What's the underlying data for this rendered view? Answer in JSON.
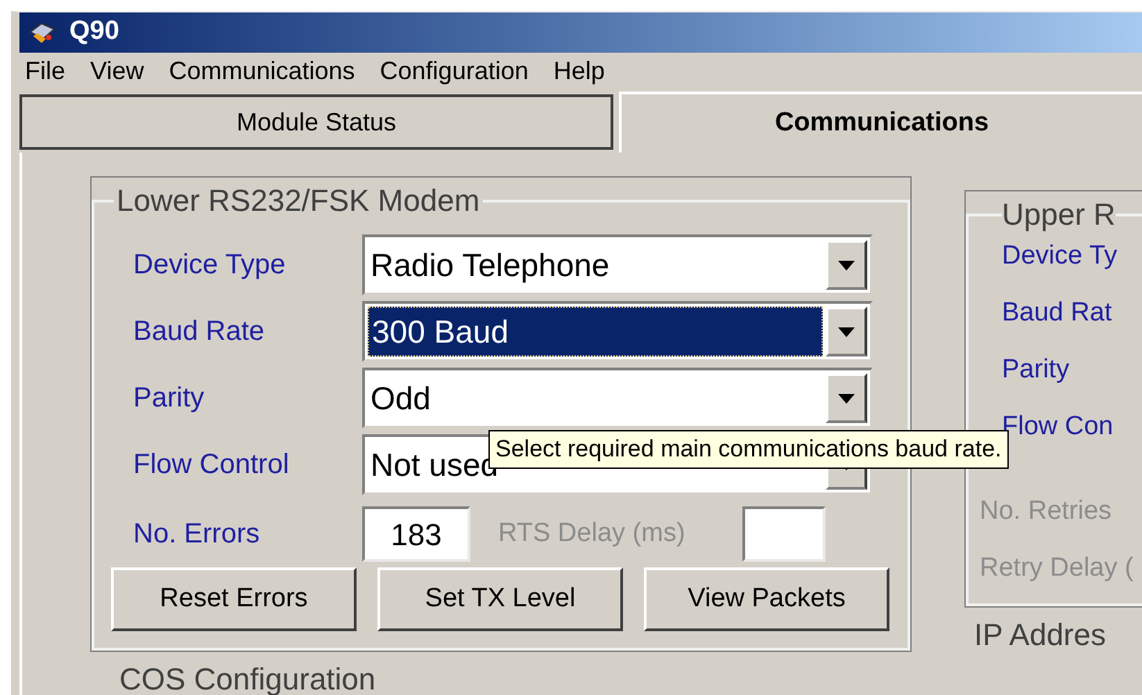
{
  "window": {
    "title": "Q90"
  },
  "menu": [
    "File",
    "View",
    "Communications",
    "Configuration",
    "Help"
  ],
  "tabs": [
    {
      "label": "Module Status",
      "selected": false
    },
    {
      "label": "Communications",
      "selected": true
    }
  ],
  "lower_group": {
    "title": "Lower RS232/FSK Modem",
    "fields": [
      {
        "label": "Device Type",
        "value": "Radio Telephone",
        "focused": false
      },
      {
        "label": "Baud Rate",
        "value": "300 Baud",
        "focused": true
      },
      {
        "label": "Parity",
        "value": "Odd",
        "focused": false
      },
      {
        "label": "Flow Control",
        "value": "Not used",
        "focused": false
      }
    ],
    "errors": {
      "label": "No. Errors",
      "value": "183",
      "disabled": false
    },
    "rts_delay": {
      "label": "RTS Delay (ms)",
      "disabled": true
    },
    "buttons": [
      "Reset Errors",
      "Set TX Level",
      "View Packets"
    ]
  },
  "cos_group": {
    "title": "COS Configuration"
  },
  "upper_group": {
    "title": "Upper R",
    "labels": [
      {
        "text": "Device Ty",
        "disabled": false
      },
      {
        "text": "Baud Rat",
        "disabled": false
      },
      {
        "text": "Parity",
        "disabled": false
      },
      {
        "text": "Flow Con",
        "disabled": false
      },
      {
        "text": "No. Retries",
        "disabled": true
      },
      {
        "text": "Retry Delay (",
        "disabled": true
      }
    ]
  },
  "ip_group": {
    "title": "IP Addres"
  },
  "tooltip": {
    "text": "Select required main communications baud rate."
  }
}
